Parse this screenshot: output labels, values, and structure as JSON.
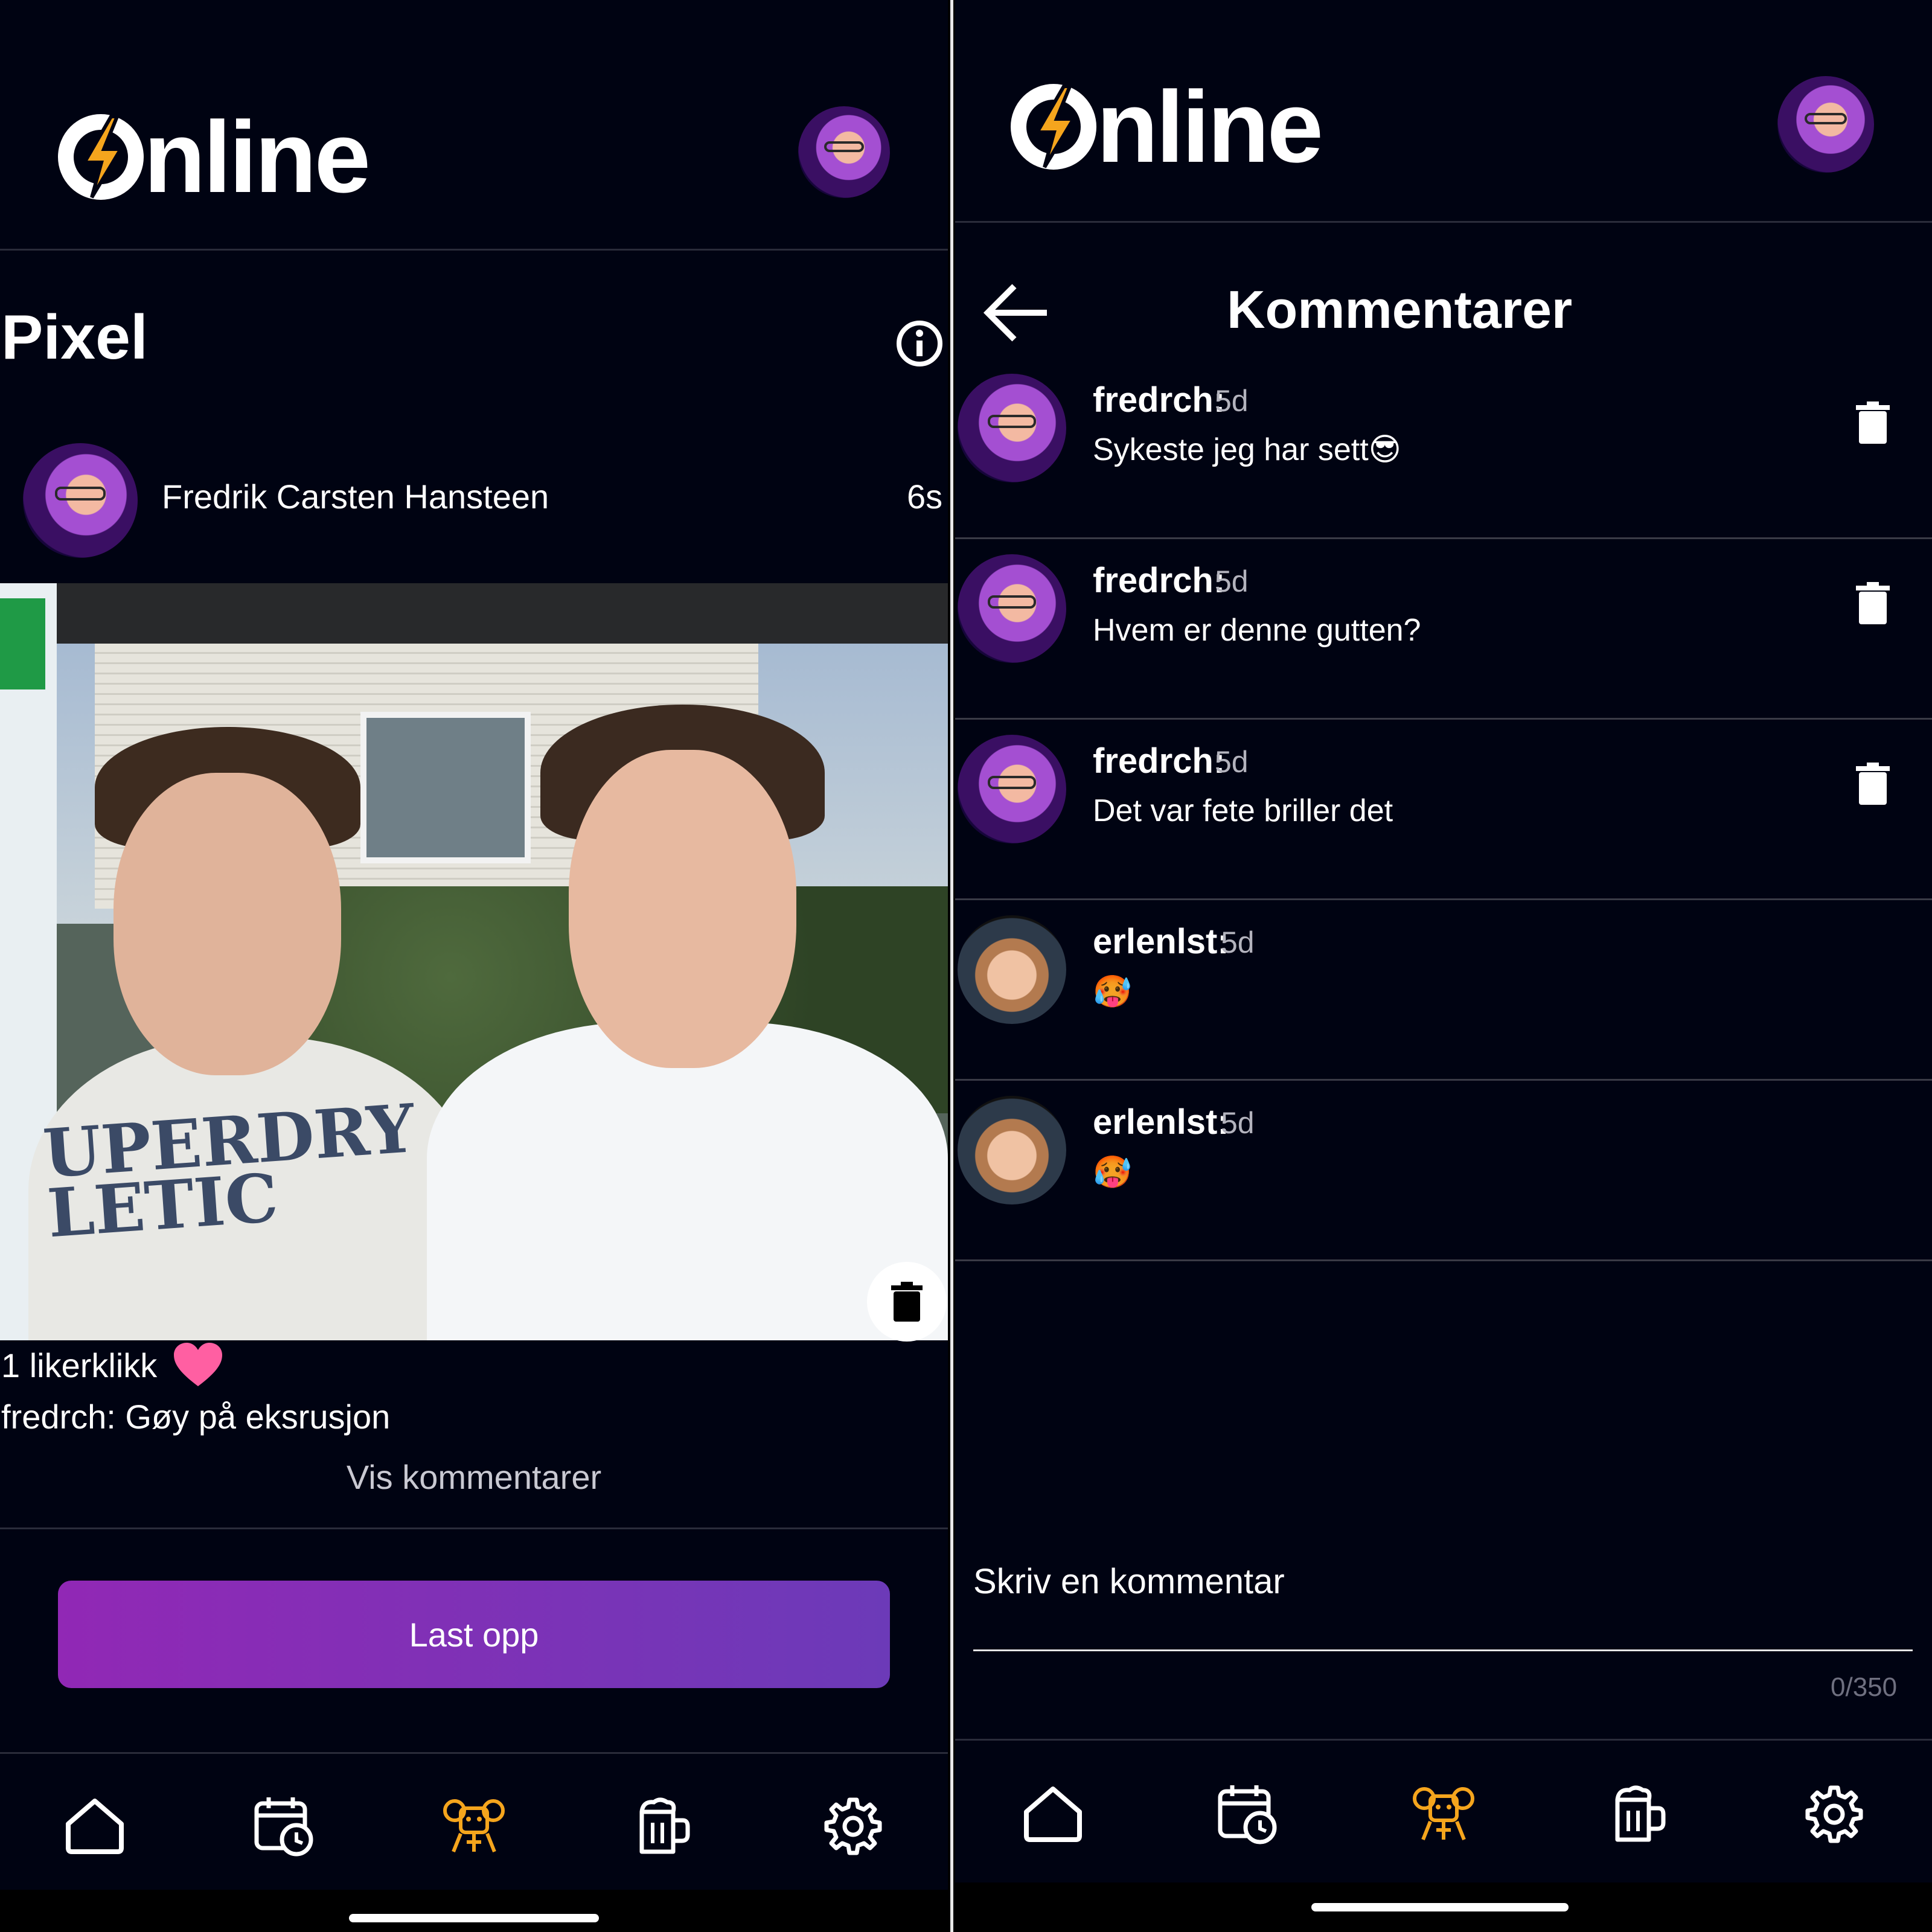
{
  "colors": {
    "background": "#000312",
    "accent_orange": "#f5a51d",
    "button_gradient_start": "#9128b5",
    "button_gradient_end": "#6c3ab8",
    "heart": "#ff5fa2"
  },
  "left": {
    "logo_text": "nline",
    "page_title": "Pixel",
    "poster_name": "Fredrik Carsten Hansteen",
    "poster_time": "6s",
    "photo_print_text": "UPERDRY\nLETIC",
    "likes_text": "1 likerklikk",
    "caption": "fredrch: Gøy på eksrusjon",
    "show_comments": "Vis kommentarer",
    "upload_button": "Last opp"
  },
  "right": {
    "logo_text": "nline",
    "title": "Kommentarer",
    "comments": [
      {
        "user": "fredrch:",
        "time": "5d",
        "text": "Sykeste jeg har sett😎",
        "deletable": true
      },
      {
        "user": "fredrch:",
        "time": "5d",
        "text": "Hvem er denne gutten?",
        "deletable": true
      },
      {
        "user": "fredrch:",
        "time": "5d",
        "text": "Det var fete briller det",
        "deletable": true
      },
      {
        "user": "erlenlst:",
        "time": "5d",
        "text": "🥵",
        "deletable": false
      },
      {
        "user": "erlenlst:",
        "time": "5d",
        "text": "🥵",
        "deletable": false
      }
    ],
    "input_placeholder": "Skriv en kommentar",
    "counter": "0/350"
  },
  "nav_items": [
    "home-icon",
    "calendar-clock-icon",
    "mascot-icon",
    "beer-mug-icon",
    "settings-icon"
  ]
}
